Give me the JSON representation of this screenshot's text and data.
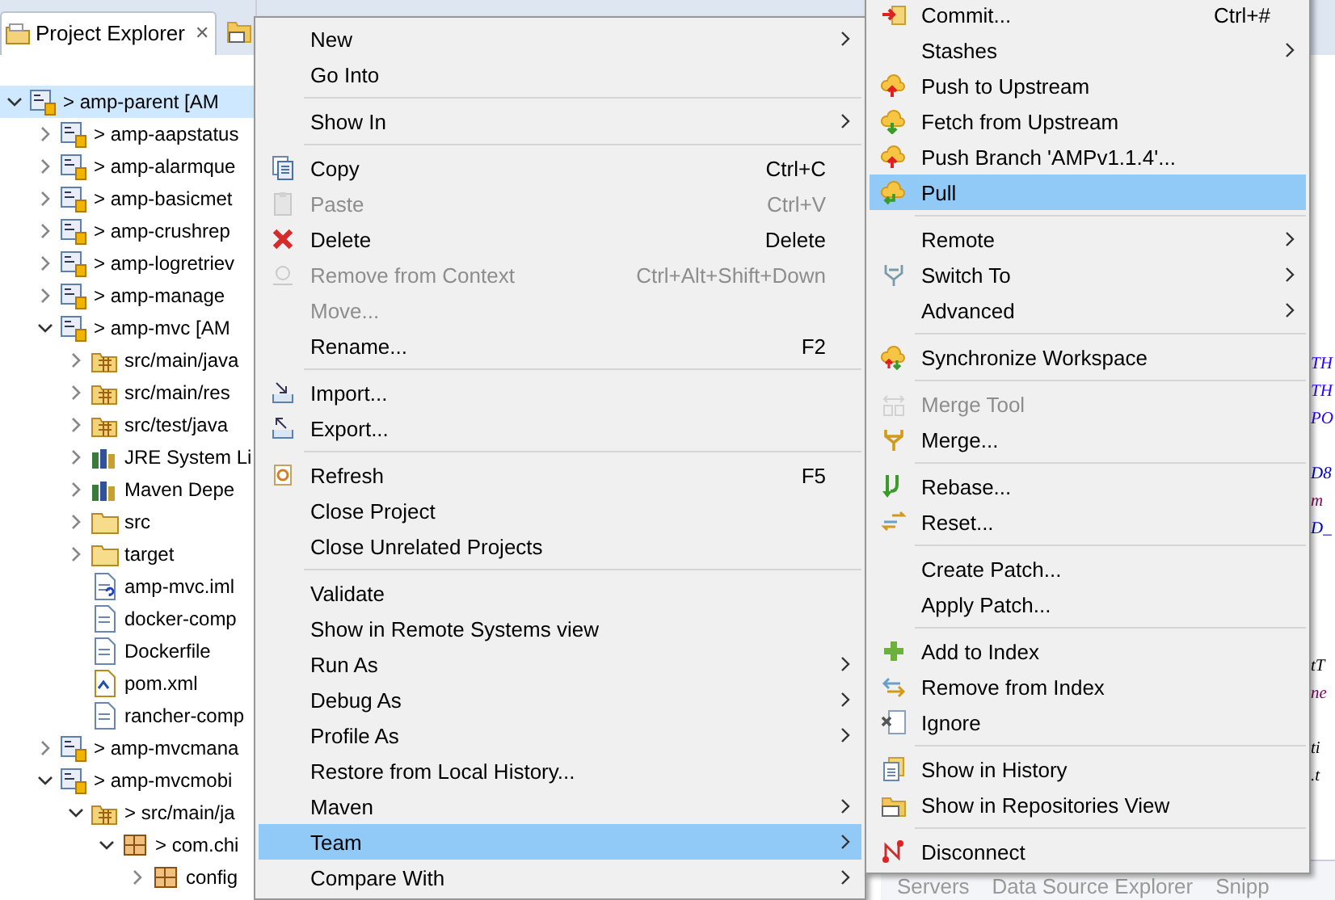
{
  "explorer": {
    "tab": {
      "title": "Project Explorer",
      "close": "✕"
    },
    "tree": [
      {
        "label": "> amp-parent  [AM",
        "kind": "project",
        "selected": true,
        "expanded": true,
        "children": [
          {
            "label": "> amp-aapstatus",
            "kind": "project",
            "selected": false,
            "expanded": false
          },
          {
            "label": "> amp-alarmque",
            "kind": "project",
            "selected": false,
            "expanded": false
          },
          {
            "label": "> amp-basicmet",
            "kind": "project",
            "selected": false,
            "expanded": false
          },
          {
            "label": "> amp-crushrep",
            "kind": "project",
            "selected": false,
            "expanded": false
          },
          {
            "label": "> amp-logretriev",
            "kind": "project",
            "selected": false,
            "expanded": false
          },
          {
            "label": "> amp-manage",
            "kind": "project",
            "selected": false,
            "expanded": false
          },
          {
            "label": "> amp-mvc  [AM",
            "kind": "project",
            "selected": false,
            "expanded": true,
            "children": [
              {
                "label": "src/main/java",
                "kind": "source-folder",
                "selected": false,
                "expanded": false
              },
              {
                "label": "src/main/res",
                "kind": "source-folder",
                "selected": false,
                "expanded": false
              },
              {
                "label": "src/test/java",
                "kind": "source-folder",
                "selected": false,
                "expanded": false
              },
              {
                "label": "JRE System Li",
                "kind": "library",
                "selected": false,
                "expanded": false
              },
              {
                "label": "Maven Depe",
                "kind": "library",
                "selected": false,
                "expanded": false
              },
              {
                "label": "src",
                "kind": "folder",
                "selected": false,
                "expanded": false
              },
              {
                "label": "target",
                "kind": "folder",
                "selected": false,
                "expanded": false
              },
              {
                "label": "amp-mvc.iml",
                "kind": "unknown-file",
                "selected": false
              },
              {
                "label": "docker-comp",
                "kind": "file",
                "selected": false
              },
              {
                "label": "Dockerfile",
                "kind": "file",
                "selected": false
              },
              {
                "label": "pom.xml",
                "kind": "xml-file",
                "selected": false
              },
              {
                "label": "rancher-comp",
                "kind": "file",
                "selected": false
              }
            ]
          },
          {
            "label": "> amp-mvcmana",
            "kind": "project",
            "selected": false,
            "expanded": false
          },
          {
            "label": "> amp-mvcmobi",
            "kind": "project",
            "selected": false,
            "expanded": true,
            "children": [
              {
                "label": "> src/main/ja",
                "kind": "source-folder",
                "selected": false,
                "expanded": true,
                "children": [
                  {
                    "label": "> com.chi",
                    "kind": "package",
                    "selected": false,
                    "expanded": true,
                    "children": [
                      {
                        "label": "config",
                        "kind": "package",
                        "selected": false,
                        "expanded": false
                      }
                    ]
                  }
                ]
              }
            ]
          }
        ]
      }
    ]
  },
  "editor": {
    "code_fragments": [
      {
        "text": "TH",
        "color": "#2a00ff"
      },
      {
        "text": "TH",
        "color": "#2a00ff"
      },
      {
        "text": "PO",
        "color": "#2a00ff"
      },
      {
        "text": "D8",
        "color": "#0000c0"
      },
      {
        "text": "m",
        "color": "#7f0055"
      },
      {
        "text": "D_",
        "color": "#0000c0"
      },
      {
        "text": "tT",
        "color": "#000000"
      },
      {
        "text": "ne",
        "color": "#7f0055"
      },
      {
        "text": "ti",
        "color": "#000000"
      },
      {
        "text": ".t",
        "color": "#000000"
      }
    ],
    "bottom_tabs": [
      "Servers",
      "Data Source Explorer",
      "Snipp"
    ]
  },
  "context_menu": {
    "items": [
      {
        "kind": "item",
        "label": "New",
        "submenu": true,
        "disabled": false,
        "selected": false
      },
      {
        "kind": "item",
        "label": "Go Into",
        "submenu": false,
        "disabled": false,
        "selected": false
      },
      {
        "kind": "separator"
      },
      {
        "kind": "item",
        "label": "Show In",
        "submenu": true,
        "disabled": false,
        "selected": false
      },
      {
        "kind": "separator"
      },
      {
        "kind": "item",
        "label": "Copy",
        "shortcut": "Ctrl+C",
        "submenu": false,
        "disabled": false,
        "selected": false
      },
      {
        "kind": "item",
        "label": "Paste",
        "shortcut": "Ctrl+V",
        "submenu": false,
        "disabled": true,
        "selected": false
      },
      {
        "kind": "item",
        "label": "Delete",
        "shortcut": "Delete",
        "submenu": false,
        "disabled": false,
        "selected": false
      },
      {
        "kind": "item",
        "label": "Remove from Context",
        "shortcut": "Ctrl+Alt+Shift+Down",
        "submenu": false,
        "disabled": true,
        "selected": false
      },
      {
        "kind": "item",
        "label": "Move...",
        "submenu": false,
        "disabled": true,
        "selected": false
      },
      {
        "kind": "item",
        "label": "Rename...",
        "shortcut": "F2",
        "submenu": false,
        "disabled": false,
        "selected": false
      },
      {
        "kind": "separator"
      },
      {
        "kind": "item",
        "label": "Import...",
        "submenu": false,
        "disabled": false,
        "selected": false
      },
      {
        "kind": "item",
        "label": "Export...",
        "submenu": false,
        "disabled": false,
        "selected": false
      },
      {
        "kind": "separator"
      },
      {
        "kind": "item",
        "label": "Refresh",
        "shortcut": "F5",
        "submenu": false,
        "disabled": false,
        "selected": false
      },
      {
        "kind": "item",
        "label": "Close Project",
        "submenu": false,
        "disabled": false,
        "selected": false
      },
      {
        "kind": "item",
        "label": "Close Unrelated Projects",
        "submenu": false,
        "disabled": false,
        "selected": false
      },
      {
        "kind": "separator"
      },
      {
        "kind": "item",
        "label": "Validate",
        "submenu": false,
        "disabled": false,
        "selected": false
      },
      {
        "kind": "item",
        "label": "Show in Remote Systems view",
        "submenu": false,
        "disabled": false,
        "selected": false
      },
      {
        "kind": "item",
        "label": "Run As",
        "submenu": true,
        "disabled": false,
        "selected": false
      },
      {
        "kind": "item",
        "label": "Debug As",
        "submenu": true,
        "disabled": false,
        "selected": false
      },
      {
        "kind": "item",
        "label": "Profile As",
        "submenu": true,
        "disabled": false,
        "selected": false
      },
      {
        "kind": "item",
        "label": "Restore from Local History...",
        "submenu": false,
        "disabled": false,
        "selected": false
      },
      {
        "kind": "item",
        "label": "Maven",
        "submenu": true,
        "disabled": false,
        "selected": false
      },
      {
        "kind": "item",
        "label": "Team",
        "submenu": true,
        "disabled": false,
        "selected": true
      },
      {
        "kind": "item",
        "label": "Compare With",
        "submenu": true,
        "disabled": false,
        "selected": false
      }
    ]
  },
  "team_submenu": {
    "items": [
      {
        "kind": "item",
        "label": "Commit...",
        "shortcut": "Ctrl+#",
        "submenu": false,
        "disabled": false,
        "selected": false
      },
      {
        "kind": "item",
        "label": "Stashes",
        "submenu": true,
        "disabled": false,
        "selected": false
      },
      {
        "kind": "item",
        "label": "Push to Upstream",
        "submenu": false,
        "disabled": false,
        "selected": false
      },
      {
        "kind": "item",
        "label": "Fetch from Upstream",
        "submenu": false,
        "disabled": false,
        "selected": false
      },
      {
        "kind": "item",
        "label": "Push Branch 'AMPv1.1.4'...",
        "submenu": false,
        "disabled": false,
        "selected": false
      },
      {
        "kind": "item",
        "label": "Pull",
        "submenu": false,
        "disabled": false,
        "selected": true
      },
      {
        "kind": "separator"
      },
      {
        "kind": "item",
        "label": "Remote",
        "submenu": true,
        "disabled": false,
        "selected": false
      },
      {
        "kind": "item",
        "label": "Switch To",
        "submenu": true,
        "disabled": false,
        "selected": false
      },
      {
        "kind": "item",
        "label": "Advanced",
        "submenu": true,
        "disabled": false,
        "selected": false
      },
      {
        "kind": "separator"
      },
      {
        "kind": "item",
        "label": "Synchronize Workspace",
        "submenu": false,
        "disabled": false,
        "selected": false
      },
      {
        "kind": "separator"
      },
      {
        "kind": "item",
        "label": "Merge Tool",
        "submenu": false,
        "disabled": true,
        "selected": false
      },
      {
        "kind": "item",
        "label": "Merge...",
        "submenu": false,
        "disabled": false,
        "selected": false
      },
      {
        "kind": "separator"
      },
      {
        "kind": "item",
        "label": "Rebase...",
        "submenu": false,
        "disabled": false,
        "selected": false
      },
      {
        "kind": "item",
        "label": "Reset...",
        "submenu": false,
        "disabled": false,
        "selected": false
      },
      {
        "kind": "separator"
      },
      {
        "kind": "item",
        "label": "Create Patch...",
        "submenu": false,
        "disabled": false,
        "selected": false
      },
      {
        "kind": "item",
        "label": "Apply Patch...",
        "submenu": false,
        "disabled": false,
        "selected": false
      },
      {
        "kind": "separator"
      },
      {
        "kind": "item",
        "label": "Add to Index",
        "submenu": false,
        "disabled": false,
        "selected": false
      },
      {
        "kind": "item",
        "label": "Remove from Index",
        "submenu": false,
        "disabled": false,
        "selected": false
      },
      {
        "kind": "item",
        "label": "Ignore",
        "submenu": false,
        "disabled": false,
        "selected": false
      },
      {
        "kind": "separator"
      },
      {
        "kind": "item",
        "label": "Show in History",
        "submenu": false,
        "disabled": false,
        "selected": false
      },
      {
        "kind": "item",
        "label": "Show in Repositories View",
        "submenu": false,
        "disabled": false,
        "selected": false
      },
      {
        "kind": "separator"
      },
      {
        "kind": "item",
        "label": "Disconnect",
        "submenu": false,
        "disabled": false,
        "selected": false
      }
    ]
  }
}
